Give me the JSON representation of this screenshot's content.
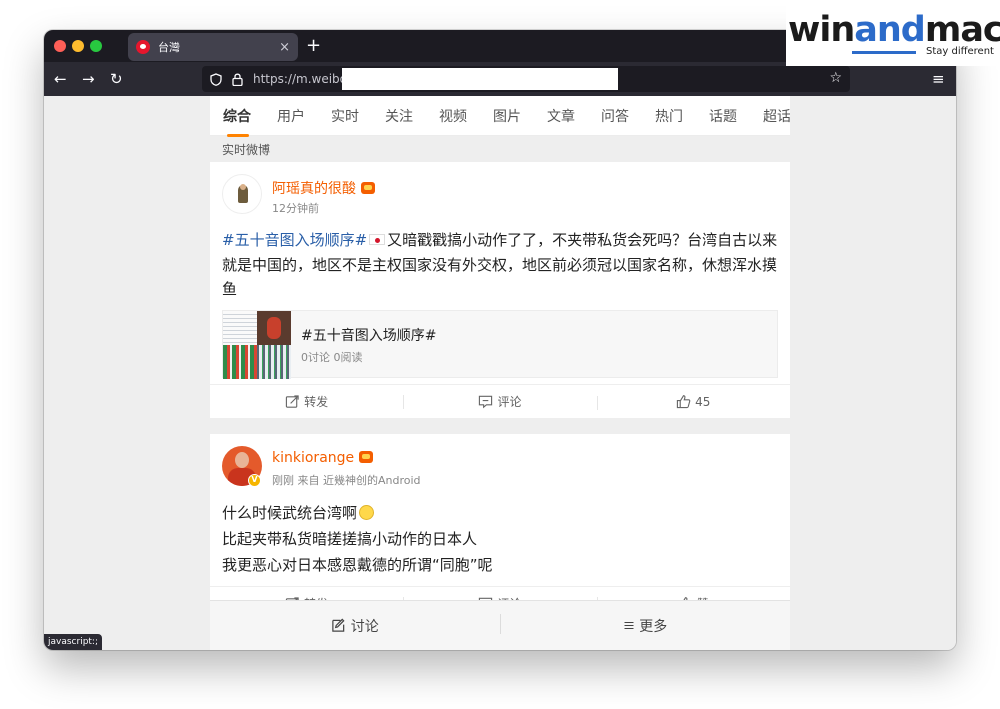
{
  "logo": {
    "part1": "win",
    "part2": "and",
    "part3": "mac",
    "tagline": "Stay different"
  },
  "browser": {
    "tab_title": "台灣",
    "tab_close": "×",
    "new_tab": "+",
    "url": "https://m.weibo.cn",
    "back": "←",
    "forward": "→",
    "reload": "↻",
    "bookmark": "☆",
    "menu": "≡",
    "status_text": "javascript:;"
  },
  "nav_tabs": [
    "综合",
    "用户",
    "实时",
    "关注",
    "视频",
    "图片",
    "文章",
    "问答",
    "热门",
    "话题",
    "超话"
  ],
  "section_label": "实时微博",
  "posts": [
    {
      "username": "阿瑶真的很酸",
      "meta": "12分钟前",
      "hashtag": "#五十音图入场顺序#",
      "text": "又暗戳戳搞小动作了了，不夹带私货会死吗？台湾自古以来就是中国的，地区不是主权国家没有外交权，地区前必须冠以国家名称，休想浑水摸鱼",
      "link_card": {
        "title": "#五十音图入场顺序#",
        "subtitle": "0讨论 0阅读"
      },
      "actions": {
        "repost": "转发",
        "comment": "评论",
        "like": "45"
      }
    },
    {
      "username": "kinkiorange",
      "meta": "刚刚 来自 近幾神创的Android",
      "lines": [
        "什么时候武统台湾啊",
        "比起夹带私货暗搓搓搞小动作的日本人",
        "我更恶心对日本感恩戴德的所谓“同胞”呢"
      ],
      "actions": {
        "repost": "转发",
        "comment": "评论",
        "like": "赞"
      }
    }
  ],
  "bottom_bar": {
    "discuss": "讨论",
    "more": "更多"
  },
  "colors": {
    "accent": "#ff8200",
    "username": "#f45e00",
    "hashtag": "#2a5fa8"
  }
}
